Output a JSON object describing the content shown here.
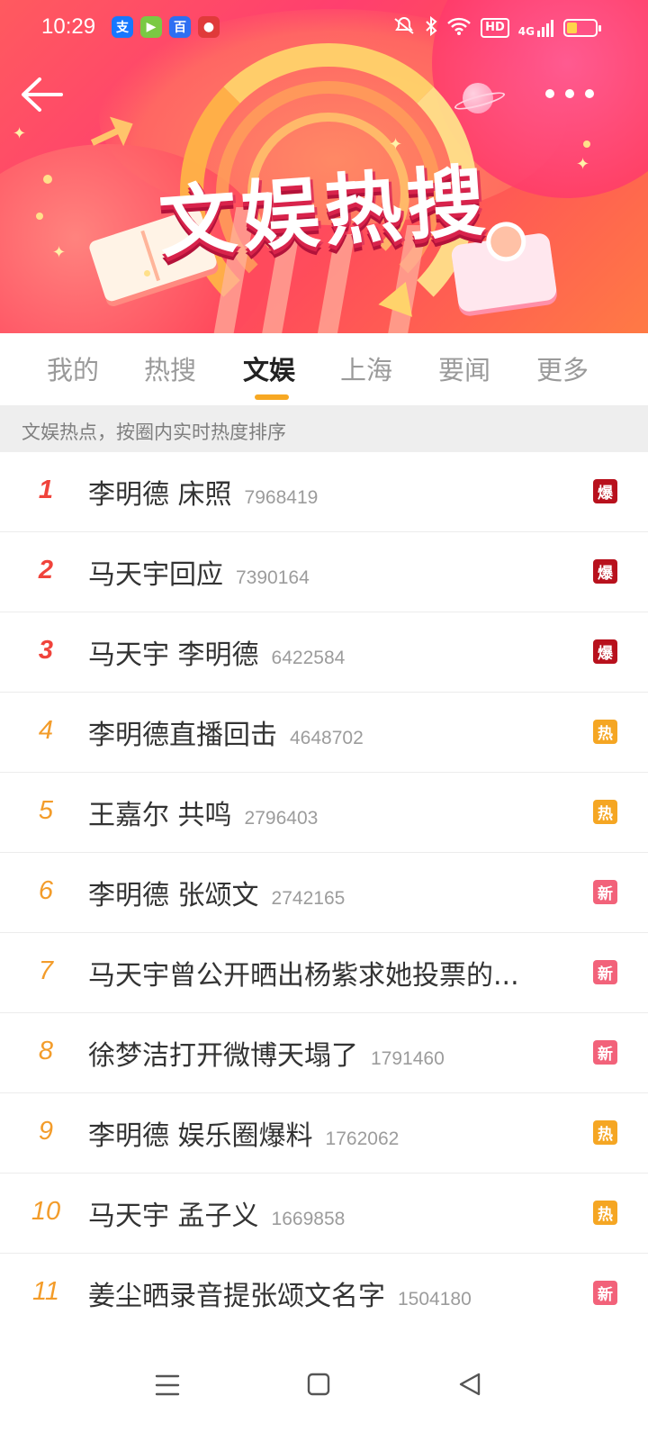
{
  "status_bar": {
    "time": "10:29",
    "app_icons": [
      {
        "name": "alipay-icon",
        "glyph": "支",
        "color": "#1677ff"
      },
      {
        "name": "video-app-icon",
        "glyph": "▶",
        "color": "#7ac943"
      },
      {
        "name": "baidu-icon",
        "glyph": "百",
        "color": "#2e6ff2"
      },
      {
        "name": "map-app-icon",
        "glyph": "●",
        "color": "#e03a3a"
      }
    ],
    "hd_label": "HD",
    "network_label": "4G",
    "battery_level": 0.35
  },
  "banner": {
    "title": "文娱热搜"
  },
  "tabs": [
    {
      "label": "我的",
      "active": false
    },
    {
      "label": "热搜",
      "active": false
    },
    {
      "label": "文娱",
      "active": true
    },
    {
      "label": "上海",
      "active": false
    },
    {
      "label": "要闻",
      "active": false
    },
    {
      "label": "更多",
      "active": false
    }
  ],
  "subheader": "文娱热点，按圈内实时热度排序",
  "list": [
    {
      "rank": "1",
      "title": "李明德 床照",
      "count": "7968419",
      "badge": "爆"
    },
    {
      "rank": "2",
      "title": "马天宇回应",
      "count": "7390164",
      "badge": "爆"
    },
    {
      "rank": "3",
      "title": "马天宇 李明德",
      "count": "6422584",
      "badge": "爆"
    },
    {
      "rank": "4",
      "title": "李明德直播回击",
      "count": "4648702",
      "badge": "热"
    },
    {
      "rank": "5",
      "title": "王嘉尔 共鸣",
      "count": "2796403",
      "badge": "热"
    },
    {
      "rank": "6",
      "title": "李明德 张颂文",
      "count": "2742165",
      "badge": "新"
    },
    {
      "rank": "7",
      "title": "马天宇曾公开晒出杨紫求她投票的...",
      "count": "",
      "badge": "新"
    },
    {
      "rank": "8",
      "title": "徐梦洁打开微博天塌了",
      "count": "1791460",
      "badge": "新"
    },
    {
      "rank": "9",
      "title": "李明德 娱乐圈爆料",
      "count": "1762062",
      "badge": "热"
    },
    {
      "rank": "10",
      "title": "马天宇 孟子义",
      "count": "1669858",
      "badge": "热"
    },
    {
      "rank": "11",
      "title": "姜尘晒录音提张颂文名字",
      "count": "1504180",
      "badge": "新"
    }
  ],
  "badge_colors": {
    "爆": "#b8111d",
    "热": "#f5a623",
    "新": "#f2627a"
  },
  "rank_colors": {
    "top": "#f0433b",
    "rest": "#f39c2a"
  }
}
